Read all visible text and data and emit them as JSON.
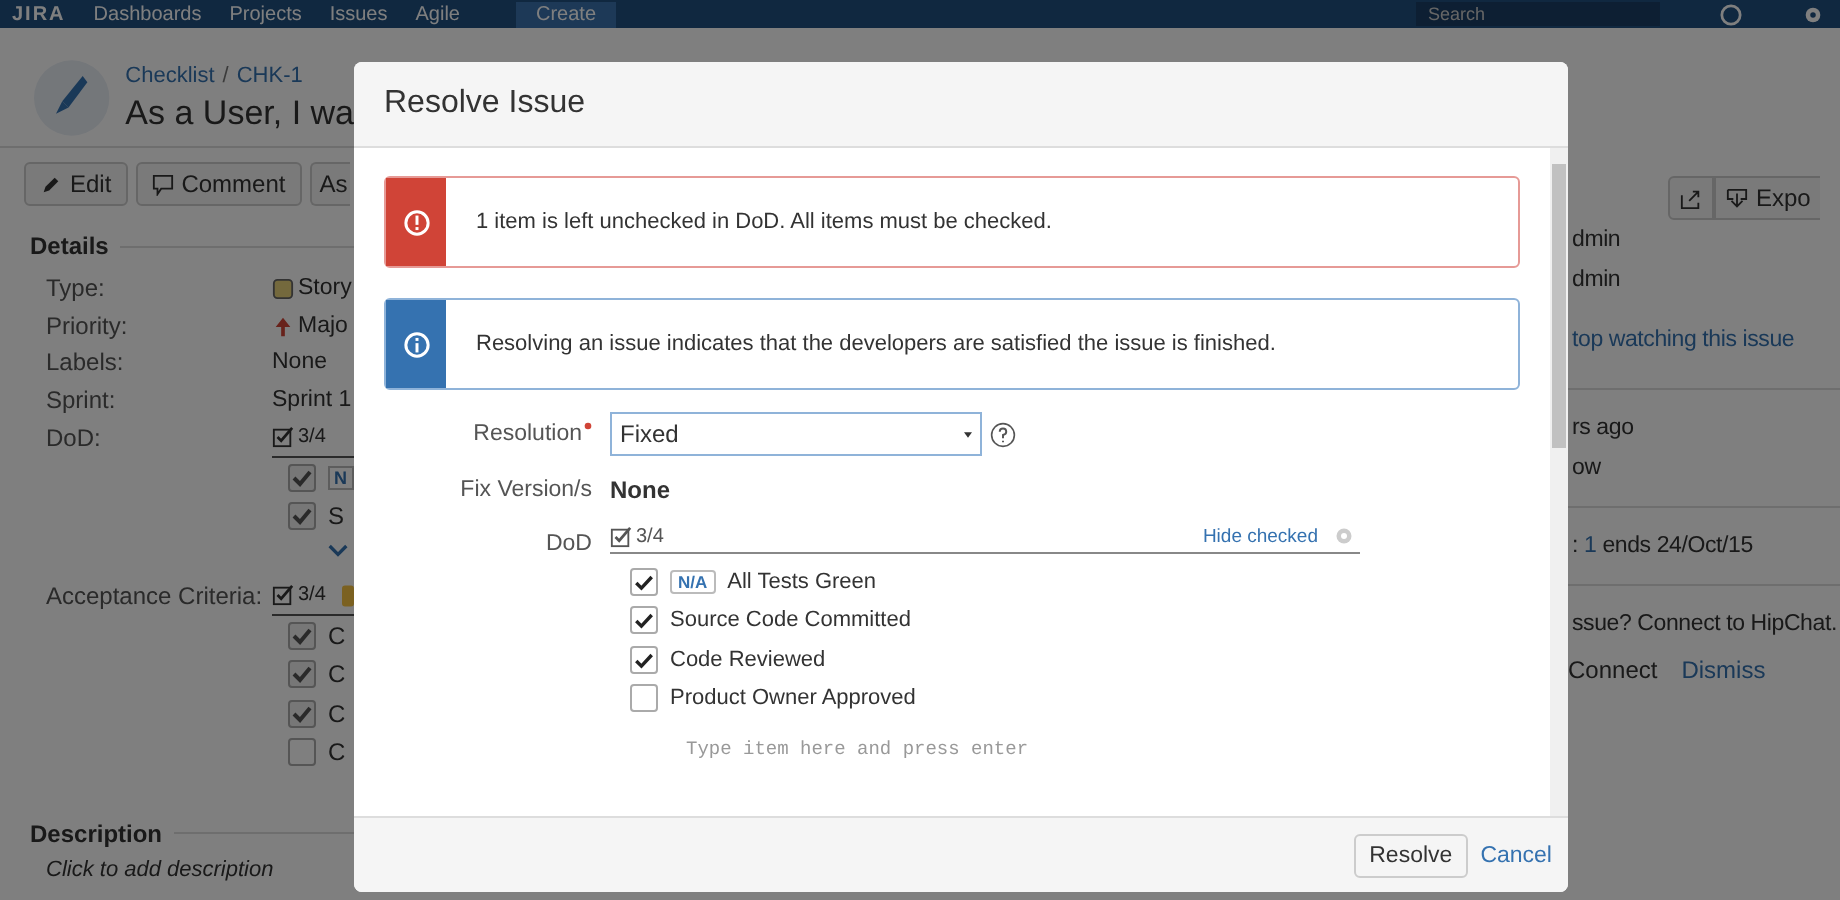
{
  "nav": {
    "logo": "JIRA",
    "items": [
      "Dashboards",
      "Projects",
      "Issues",
      "Agile"
    ],
    "create": "Create",
    "search": {
      "placeholder": "Search"
    }
  },
  "issue": {
    "breadcrumb": [
      "Checklist",
      "CHK-1"
    ],
    "separator": "/",
    "title": "As a User, I wa"
  },
  "toolbar": [
    {
      "kind": "edit",
      "label": "Edit"
    },
    {
      "kind": "comment",
      "label": "Comment"
    },
    {
      "kind": "plain",
      "label": "As"
    }
  ],
  "toolbar_right": [
    {
      "kind": "share"
    },
    {
      "kind": "export",
      "label": "Expo"
    }
  ],
  "details": {
    "heading": "Details",
    "fields": [
      {
        "label": "Type:",
        "kind": "type",
        "value": "Story"
      },
      {
        "label": "Priority:",
        "kind": "priority",
        "value": "Majo"
      },
      {
        "label": "Labels:",
        "kind": "text",
        "value": "None"
      },
      {
        "label": "Sprint:",
        "kind": "text",
        "value": "Sprint 1"
      },
      {
        "label": "DoD:",
        "kind": "checklist",
        "progress": "3/4",
        "items": [
          {
            "checked": true,
            "badge": "N"
          },
          {
            "checked": true,
            "text": "S"
          }
        ],
        "collapsed": true
      },
      {
        "label": "Acceptance Criteria:",
        "kind": "checklist",
        "progress": "3/4",
        "items": [
          {
            "checked": true,
            "text": "C"
          },
          {
            "checked": true,
            "text": "C"
          },
          {
            "checked": true,
            "text": "C"
          },
          {
            "checked": false,
            "text": "C"
          }
        ],
        "flagged": true
      }
    ]
  },
  "description": {
    "heading": "Description",
    "placeholder": "Click to add description"
  },
  "side": [
    {
      "kind": "text",
      "text": "dmin"
    },
    {
      "kind": "text",
      "text": "dmin"
    },
    {
      "kind": "link",
      "text": "top watching this issue"
    },
    {
      "kind": "divider"
    },
    {
      "kind": "text",
      "text": "rs ago"
    },
    {
      "kind": "text",
      "text": "ow"
    },
    {
      "kind": "divider"
    },
    {
      "kind": "sprint",
      "prefix": ":",
      "link": "1",
      "suffix": "ends 24/Oct/15"
    },
    {
      "kind": "divider"
    },
    {
      "kind": "text",
      "text": "ssue? Connect to HipChat."
    },
    {
      "kind": "actions",
      "items": [
        "Connect",
        "Dismiss"
      ]
    }
  ],
  "dialog": {
    "title": "Resolve Issue",
    "messages": [
      {
        "kind": "error",
        "text": "1 item is left unchecked in DoD. All items must be checked."
      },
      {
        "kind": "info",
        "text": "Resolving an issue indicates that the developers are satisfied the issue is finished."
      }
    ],
    "resolution": {
      "label": "Resolution",
      "required": true,
      "value": "Fixed"
    },
    "fix_version": {
      "label": "Fix Version/s",
      "value": "None"
    },
    "dod": {
      "label": "DoD",
      "progress": "3/4",
      "hide_link": "Hide checked",
      "items": [
        {
          "checked": true,
          "badge": "N/A",
          "text": "All Tests Green"
        },
        {
          "checked": true,
          "text": "Source Code Committed"
        },
        {
          "checked": true,
          "text": "Code Reviewed"
        },
        {
          "checked": false,
          "text": "Product Owner Approved"
        }
      ],
      "new_item": {
        "placeholder": "Type item here and press enter"
      }
    },
    "buttons": {
      "resolve": "Resolve",
      "cancel": "Cancel"
    }
  }
}
